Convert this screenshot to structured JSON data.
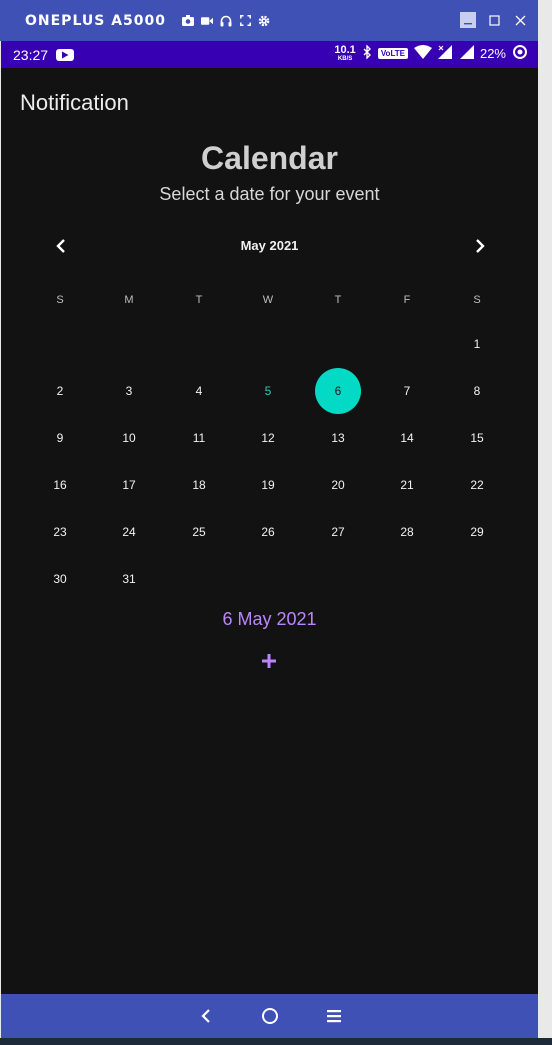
{
  "window": {
    "device_name": "ONEPLUS A5000",
    "tool_icons": [
      "camera-icon",
      "video-icon",
      "headset-icon",
      "fullscreen-icon",
      "gear-icon"
    ],
    "controls": [
      "minimize-icon",
      "maximize-icon",
      "close-icon"
    ]
  },
  "status_bar": {
    "time": "23:27",
    "net_speed_value": "10.1",
    "net_speed_unit": "KB/S",
    "volte": "VoLTE",
    "battery": "22%"
  },
  "app": {
    "title": "Notification"
  },
  "calendar": {
    "title": "Calendar",
    "subtitle": "Select a date for your event",
    "month_label": "May 2021",
    "weekdays": [
      "S",
      "M",
      "T",
      "W",
      "T",
      "F",
      "S"
    ],
    "weeks": [
      [
        "",
        "",
        "",
        "",
        "",
        "",
        "1"
      ],
      [
        "2",
        "3",
        "4",
        "5",
        "6",
        "7",
        "8"
      ],
      [
        "9",
        "10",
        "11",
        "12",
        "13",
        "14",
        "15"
      ],
      [
        "16",
        "17",
        "18",
        "19",
        "20",
        "21",
        "22"
      ],
      [
        "23",
        "24",
        "25",
        "26",
        "27",
        "28",
        "29"
      ],
      [
        "30",
        "31",
        "",
        "",
        "",
        "",
        ""
      ]
    ],
    "today": "5",
    "selected": "6",
    "selected_date_text": "6 May 2021",
    "add_label": "+"
  },
  "colors": {
    "titlebar": "#3f51b5",
    "statusbar": "#3700b3",
    "background": "#121212",
    "selected_circle": "#03dac5",
    "accent_purple": "#bb86fc",
    "today_text": "#26d0b5"
  },
  "nav_bar": [
    "back-icon",
    "home-icon",
    "menu-icon"
  ]
}
